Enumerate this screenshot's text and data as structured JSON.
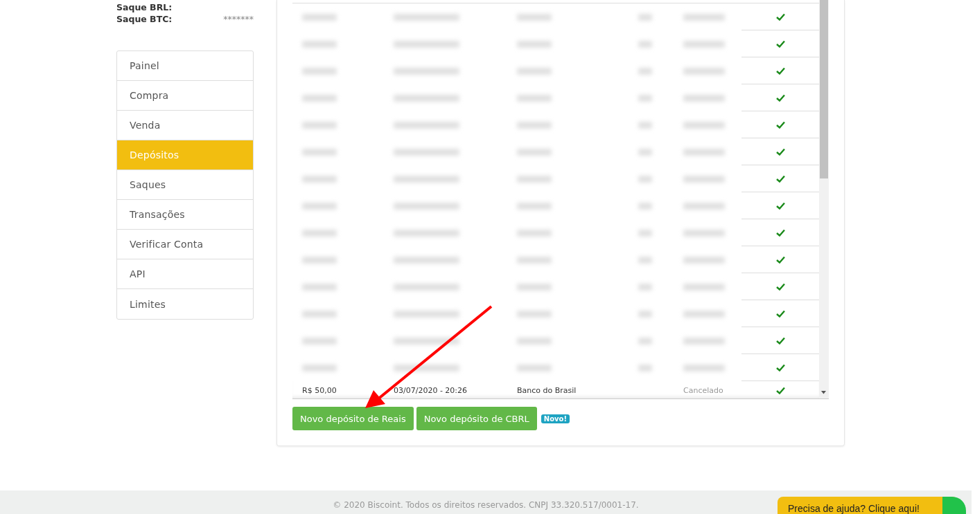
{
  "balances": [
    {
      "label": "Saque BRL:"
    },
    {
      "label": "Saque BTC:",
      "value": "*******"
    }
  ],
  "sidebar": {
    "items": [
      {
        "label": "Painel",
        "selected": false
      },
      {
        "label": "Compra",
        "selected": false
      },
      {
        "label": "Venda",
        "selected": false
      },
      {
        "label": "Depósitos",
        "selected": true
      },
      {
        "label": "Saques",
        "selected": false
      },
      {
        "label": "Transações",
        "selected": false
      },
      {
        "label": "Verificar Conta",
        "selected": false
      },
      {
        "label": "API",
        "selected": false
      },
      {
        "label": "Limites",
        "selected": false
      }
    ]
  },
  "deposits": {
    "rows": [
      {
        "kind": "redacted",
        "confirmed": true
      },
      {
        "kind": "redacted",
        "confirmed": true
      },
      {
        "kind": "redacted",
        "confirmed": true
      },
      {
        "kind": "redacted",
        "confirmed": true
      },
      {
        "kind": "redacted",
        "confirmed": true
      },
      {
        "kind": "redacted",
        "confirmed": true
      },
      {
        "kind": "redacted",
        "confirmed": true
      },
      {
        "kind": "redacted",
        "confirmed": true
      },
      {
        "kind": "redacted",
        "confirmed": true
      },
      {
        "kind": "redacted",
        "confirmed": true
      },
      {
        "kind": "redacted",
        "confirmed": true
      },
      {
        "kind": "redacted",
        "confirmed": true
      },
      {
        "kind": "redacted",
        "confirmed": true
      },
      {
        "kind": "redacted",
        "confirmed": true
      },
      {
        "kind": "text",
        "confirmed": true,
        "cells": [
          "R$ 50,00",
          "03/07/2020 - 20:26",
          "Banco do Brasil",
          "",
          "Cancelado"
        ]
      }
    ]
  },
  "buttons": [
    {
      "label": "Novo depósito de Reais"
    },
    {
      "label": "Novo depósito de CBRL"
    }
  ],
  "new_badge": "Novo!",
  "footer": "© 2020 Biscoint. Todos os direitos reservados. CNPJ 33.320.517/0001-17.",
  "help_widget": "Precisa de ajuda? Clique aqui!"
}
